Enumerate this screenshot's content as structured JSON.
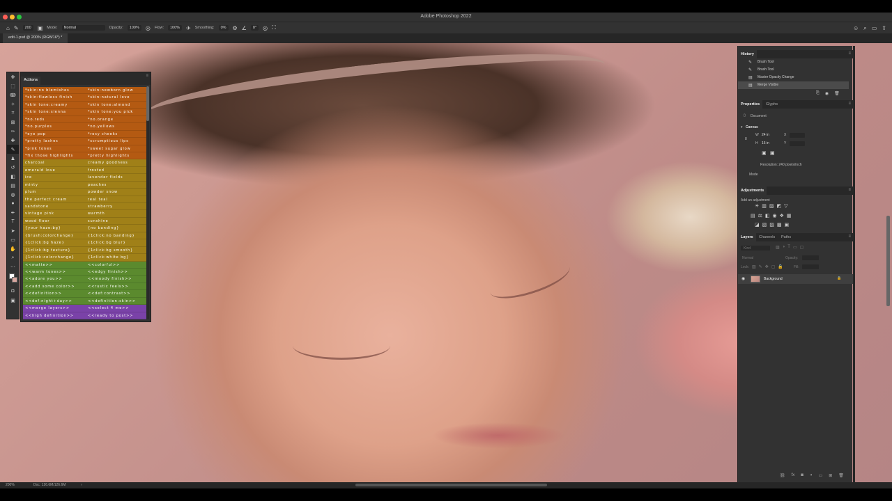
{
  "window": {
    "title": "Adobe Photoshop 2022",
    "traffic_colors": [
      "#fe5f57",
      "#febc2e",
      "#28c840"
    ]
  },
  "options_bar": {
    "brush_size": "200",
    "mode_label": "Mode:",
    "mode_value": "Normal",
    "opacity_label": "Opacity:",
    "opacity_value": "100%",
    "flow_label": "Flow:",
    "flow_value": "100%",
    "smoothing_label": "Smoothing:",
    "smoothing_value": "0%",
    "angle_value": "0°"
  },
  "document": {
    "tab_label": "edit-1.psd @ 200% (RGB/16*) *"
  },
  "status": {
    "zoom": "200%",
    "doc_info": "Doc: 126.6M/126.6M"
  },
  "actions_panel": {
    "title": "Actions",
    "rows": [
      {
        "left": "*skin:no blemishes",
        "right": "*skin:newborn glow",
        "color": "#b45a12"
      },
      {
        "left": "*skin:flawless finish",
        "right": "*skin:natural love",
        "color": "#b45a12"
      },
      {
        "left": "*skin tone:creamy",
        "right": "*skin tone:almond",
        "color": "#b45a12"
      },
      {
        "left": "*skin tone:sienna",
        "right": "*skin tone:you pick",
        "color": "#b45a12"
      },
      {
        "left": "*no.reds",
        "right": "*no.orange",
        "color": "#b45a12"
      },
      {
        "left": "*no.purples",
        "right": "*no.yellows",
        "color": "#b45a12"
      },
      {
        "left": "*eye pop",
        "right": "*rosy cheeks",
        "color": "#b45a12"
      },
      {
        "left": "*pretty lashes",
        "right": "*scrumptious lips",
        "color": "#b45a12"
      },
      {
        "left": "*pink tones",
        "right": "*sweet sugar glow",
        "color": "#b45a12"
      },
      {
        "left": "*fix those highlights",
        "right": "*pretty highlights",
        "color": "#b45a12"
      },
      {
        "left": "charcoal",
        "right": "creamy goodness",
        "color": "#a08018"
      },
      {
        "left": "emerald love",
        "right": "frosted",
        "color": "#a08018"
      },
      {
        "left": "ice",
        "right": "lavender fields",
        "color": "#a08018"
      },
      {
        "left": "minty",
        "right": "peaches",
        "color": "#a08018"
      },
      {
        "left": "plum",
        "right": "powder snow",
        "color": "#a08018"
      },
      {
        "left": "the perfect cream",
        "right": "real teal",
        "color": "#a08018"
      },
      {
        "left": "sandstone",
        "right": "strawberry",
        "color": "#a08018"
      },
      {
        "left": "vintage pink",
        "right": "warmth",
        "color": "#a08018"
      },
      {
        "left": "wood floor",
        "right": "sunshine",
        "color": "#a08018"
      },
      {
        "left": "{your haze:bg}",
        "right": "{no banding}",
        "color": "#a08018"
      },
      {
        "left": "{brush:colorchange}",
        "right": "{1click:no banding}",
        "color": "#a08018"
      },
      {
        "left": "{1click:bg haze}",
        "right": "{1click:bg blur}",
        "color": "#a08018"
      },
      {
        "left": "{1click:bg texture}",
        "right": "{1click:bg smooth}",
        "color": "#a08018"
      },
      {
        "left": "{1click:colorchange}",
        "right": "{1click:white bg}",
        "color": "#a08018"
      },
      {
        "left": "<<matte>>",
        "right": "<<colorful>>",
        "color": "#5b8a2e"
      },
      {
        "left": "<<warm tones>>",
        "right": "<<edgy finish>>",
        "color": "#5b8a2e"
      },
      {
        "left": "<<adore you>>",
        "right": "<<moody finish>>",
        "color": "#5b8a2e"
      },
      {
        "left": "<<add some color>>",
        "right": "<<rustic feels>>",
        "color": "#5b8a2e"
      },
      {
        "left": "<<definition>>",
        "right": "<<def:contrast>>",
        "color": "#5b8a2e"
      },
      {
        "left": "<<def:night+day>>",
        "right": "<<definition:skin>>",
        "color": "#5b8a2e"
      },
      {
        "left": "<<merge layers>>",
        "right": "<<select 4 me>>",
        "color": "#7a42a8"
      },
      {
        "left": "<<high definition>>",
        "right": "<<ready to post>>",
        "color": "#7a42a8"
      }
    ]
  },
  "history_panel": {
    "title": "History",
    "items": [
      {
        "label": "Brush Tool",
        "selected": false
      },
      {
        "label": "Brush Tool",
        "selected": false
      },
      {
        "label": "Master Opacity Change",
        "selected": false
      },
      {
        "label": "Merge Visible",
        "selected": true
      }
    ]
  },
  "properties_panel": {
    "tabs": [
      "Properties",
      "Glyphs"
    ],
    "doc_label": "Document",
    "section": "Canvas",
    "w_label": "W",
    "w_value": "24 in",
    "h_label": "H",
    "h_value": "16 in",
    "x_label": "X",
    "y_label": "Y",
    "resolution": "Resolution: 240 pixels/inch",
    "mode_label": "Mode"
  },
  "adjustments_panel": {
    "title": "Adjustments",
    "hint": "Add an adjustment"
  },
  "layers_panel": {
    "tabs": [
      "Layers",
      "Channels",
      "Paths"
    ],
    "filter_placeholder": "Kind",
    "blend_mode": "Normal",
    "opacity_label": "Opacity:",
    "lock_label": "Lock:",
    "fill_label": "Fill:",
    "layer_name": "Background"
  }
}
